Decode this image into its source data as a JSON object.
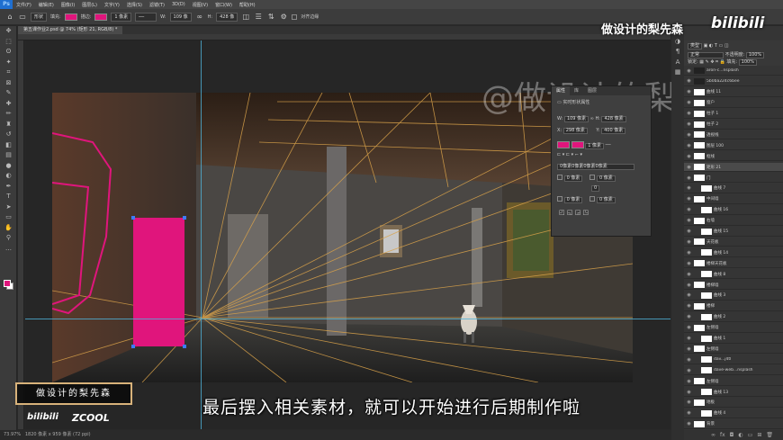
{
  "menu": {
    "items": [
      "文件(F)",
      "编辑(E)",
      "图像(I)",
      "图层(L)",
      "文字(Y)",
      "选择(S)",
      "滤镜(T)",
      "3D(D)",
      "视图(V)",
      "窗口(W)",
      "帮助(H)"
    ]
  },
  "options": {
    "mode": "形状",
    "fill_label": "填充:",
    "stroke_label": "描边:",
    "stroke_width": "1 像素",
    "w_label": "W:",
    "w_value": "109 像",
    "h_label": "H:",
    "h_value": "428 像",
    "align_label": "对齐边缘",
    "fill_color": "#e0157c"
  },
  "document": {
    "tab_title": "第五课作业2.psd @ 74% (矩形 21, RGB/8) *",
    "zoom": "73.97%",
    "dimensions": "1820 像素 x 959 像素 (72 ppi)"
  },
  "properties": {
    "tabs": [
      "属性",
      "库",
      "图层"
    ],
    "title": "实时形状属性",
    "w_label": "W:",
    "w_value": "109 像素",
    "h_label": "H:",
    "h_value": "428 像素",
    "x_label": "X:",
    "x_value": "298 像素",
    "y_label": "Y:",
    "y_value": "400 像素",
    "stroke_width": "1 像素",
    "radius_all": "0像素0像素0像素0像素",
    "radius_a": "0 像素",
    "radius_b": "0 像素",
    "radius_c": "0 像素",
    "radius_d": "0 像素",
    "link_value": "0",
    "fill_color": "#e0157c"
  },
  "layers": {
    "kind_label": "类型",
    "blend_mode": "正常",
    "opacity_label": "不透明度:",
    "opacity": "100%",
    "lock_label": "锁定:",
    "fill_label": "填充:",
    "fill": "100%",
    "rows": [
      {
        "name": "aron-c...nsplash",
        "indent": 0
      },
      {
        "name": "5b0ba224c6bee",
        "indent": 0
      },
      {
        "name": "曲线 11",
        "indent": 0
      },
      {
        "name": "窗户",
        "indent": 0
      },
      {
        "name": "柱子 1",
        "indent": 0
      },
      {
        "name": "柱子 2",
        "indent": 0
      },
      {
        "name": "透视线",
        "indent": 0
      },
      {
        "name": "图层 100",
        "indent": 0
      },
      {
        "name": "框线",
        "indent": 0
      },
      {
        "name": "矩形 21",
        "indent": 0
      },
      {
        "name": "门",
        "indent": 0
      },
      {
        "name": "曲线 7",
        "indent": 1
      },
      {
        "name": "中间墙",
        "indent": 0
      },
      {
        "name": "曲线 16",
        "indent": 1
      },
      {
        "name": "右墙",
        "indent": 0
      },
      {
        "name": "曲线 15",
        "indent": 1
      },
      {
        "name": "天花板",
        "indent": 0
      },
      {
        "name": "曲线 14",
        "indent": 1
      },
      {
        "name": "楼梯天花板",
        "indent": 0
      },
      {
        "name": "曲线 8",
        "indent": 1
      },
      {
        "name": "楼梯墙",
        "indent": 0
      },
      {
        "name": "曲线 3",
        "indent": 1
      },
      {
        "name": "楼梯",
        "indent": 0
      },
      {
        "name": "曲线 2",
        "indent": 1
      },
      {
        "name": "左侧墙",
        "indent": 0
      },
      {
        "name": "曲线 1",
        "indent": 1
      },
      {
        "name": "左侧墙",
        "indent": 0
      },
      {
        "name": "dav...j4tI",
        "indent": 1
      },
      {
        "name": "dave-web...nsplash",
        "indent": 1
      },
      {
        "name": "左侧墙",
        "indent": 0
      },
      {
        "name": "曲线 13",
        "indent": 1
      },
      {
        "name": "地板",
        "indent": 0
      },
      {
        "name": "曲线 4",
        "indent": 1
      },
      {
        "name": "背景",
        "indent": 0
      }
    ],
    "selected_index": 9
  },
  "branding": {
    "top_title": "做设计的梨先森",
    "top_bili": "bilibili",
    "box_title": "做设计的梨先森",
    "bili_small": "bilibili",
    "zcool": "ZCOOL",
    "watermark": "@做设计的梨先森"
  },
  "subtitle": "最后摆入相关素材，就可以开始进行后期制作啦",
  "icons": {
    "tools": [
      "move-icon",
      "marquee-icon",
      "lasso-icon",
      "magic-wand-icon",
      "crop-icon",
      "eyedropper-icon",
      "healing-icon",
      "brush-icon",
      "stamp-icon",
      "history-brush-icon",
      "eraser-icon",
      "gradient-icon",
      "blur-icon",
      "dodge-icon",
      "pen-icon",
      "type-icon",
      "path-select-icon",
      "rectangle-icon",
      "hand-icon",
      "zoom-icon",
      "more-icon"
    ]
  }
}
